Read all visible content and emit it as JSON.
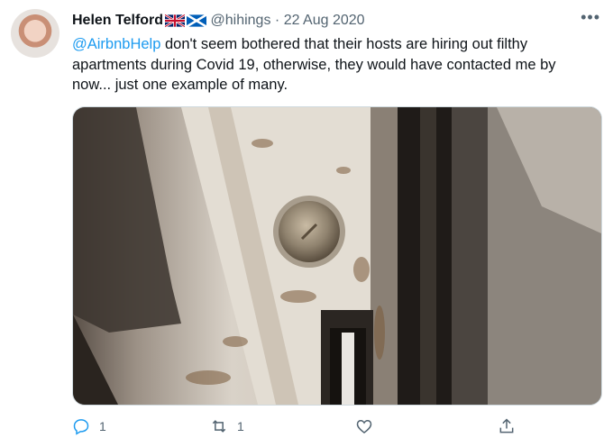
{
  "tweet": {
    "author_name": "Helen Telford",
    "flags": [
      "gb-flag-icon",
      "scotland-flag-icon"
    ],
    "handle": "@hihings",
    "separator": "·",
    "date": "22 Aug 2020",
    "mention": "@AirbnbHelp",
    "text": " don't seem bothered that their hosts are hiring out filthy apartments during Covid 19, otherwise, they would have contacted me by now... just one example of many.",
    "more_label": "•••"
  },
  "actions": {
    "reply_count": "1",
    "retweet_count": "1",
    "icons": [
      "reply-icon",
      "retweet-icon",
      "like-icon",
      "share-icon"
    ]
  },
  "colors": {
    "link": "#1d9bf0",
    "secondary": "#536471"
  }
}
